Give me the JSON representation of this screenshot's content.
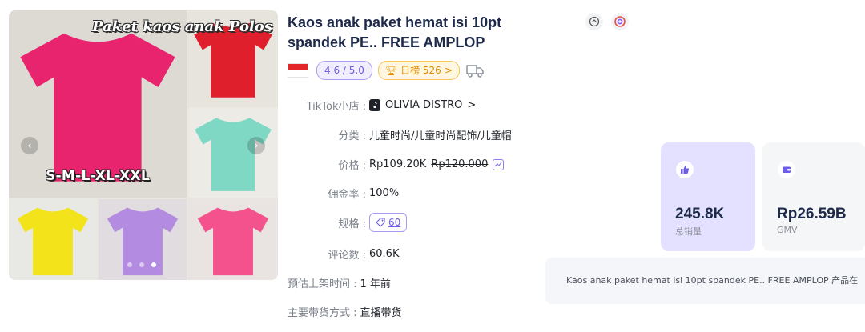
{
  "gallery": {
    "overlay_title": "Paket kaos anak Polos",
    "overlay_sizes": "S-M-L-XL-XXL",
    "shirt_colors": [
      "#e8246e",
      "#e01f2c",
      "#7fd8c4",
      "#f2e31a",
      "#b38be0",
      "#f4528c"
    ]
  },
  "product": {
    "title": "Kaos anak paket hemat isi 10pt spandek PE.. FREE AMPLOP",
    "rating": "4.6 / 5.0",
    "rank_label": "日榜 526",
    "rank_arrow": ">"
  },
  "details": {
    "shop_label": "TikTok小店 :",
    "shop_name": "OLIVIA DISTRO",
    "shop_arrow": ">",
    "category_label": "分类 :",
    "category_value": "儿童时尚/儿童时尚配饰/儿童帽",
    "price_label": "价格 :",
    "price_value": "Rp109.20K",
    "price_original": "Rp120.000",
    "commission_label": "佣金率 :",
    "commission_value": "100%",
    "spec_label": "规格 :",
    "spec_count": "60",
    "reviews_label": "评论数 :",
    "reviews_value": "60.6K",
    "listing_label": "预估上架时间 :",
    "listing_value": "1 年前",
    "sales_mode_label": "主要带货方式 :",
    "sales_mode_value": "直播带货"
  },
  "stats": {
    "sales_value": "245.8K",
    "sales_label": "总销量",
    "gmv_value": "Rp26.59B",
    "gmv_label": "GMV"
  },
  "summary_text": "Kaos anak paket hemat isi 10pt spandek PE.. FREE AMPLOP 产品在",
  "colors": {
    "accent_purple": "#6c5ce7",
    "rank_orange": "#e28c00",
    "title_navy": "#1e2a4a"
  }
}
